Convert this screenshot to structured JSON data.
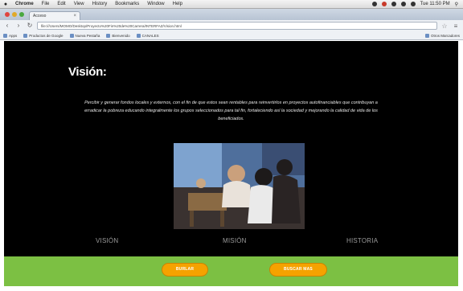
{
  "menubar": {
    "apple": "",
    "items": [
      "Chrome",
      "File",
      "Edit",
      "View",
      "History",
      "Bookmarks",
      "Window",
      "Help"
    ],
    "clock": "Tue 11:50 PM"
  },
  "browser": {
    "tab_title": "Acceso",
    "url": "file:///Users/MOMO/Desktop/Proyecto%20Fin%20de%20Carrera/INTERFAZ/Vision.html",
    "bookmarks": [
      "Apps",
      "Productos de Google",
      "Nueva Pestaña",
      "Bienvenido",
      "CANALES"
    ],
    "bookmarks_other": "Otros Marcadores"
  },
  "page": {
    "title": "Visión:",
    "vision_text": "Percibir y generar fondos locales y externos, con el fin de que estos sean rentables para reinvertirlos en proyectos autofinanciables que contribuyan a erradicar la pobreza educando integralmente los grupos seleccionados para tal fin, fortaleciendo así la sociedad y mejorando la calidad de vida de los beneficiados.",
    "nav": [
      "VISIÓN",
      "MISIÓN",
      "HISTORIA"
    ],
    "buttons": [
      "BURLAR",
      "BUSCAR MAS"
    ]
  },
  "colors": {
    "page_bg": "#000000",
    "footer": "#7cc043",
    "pill": "#f5a200"
  }
}
